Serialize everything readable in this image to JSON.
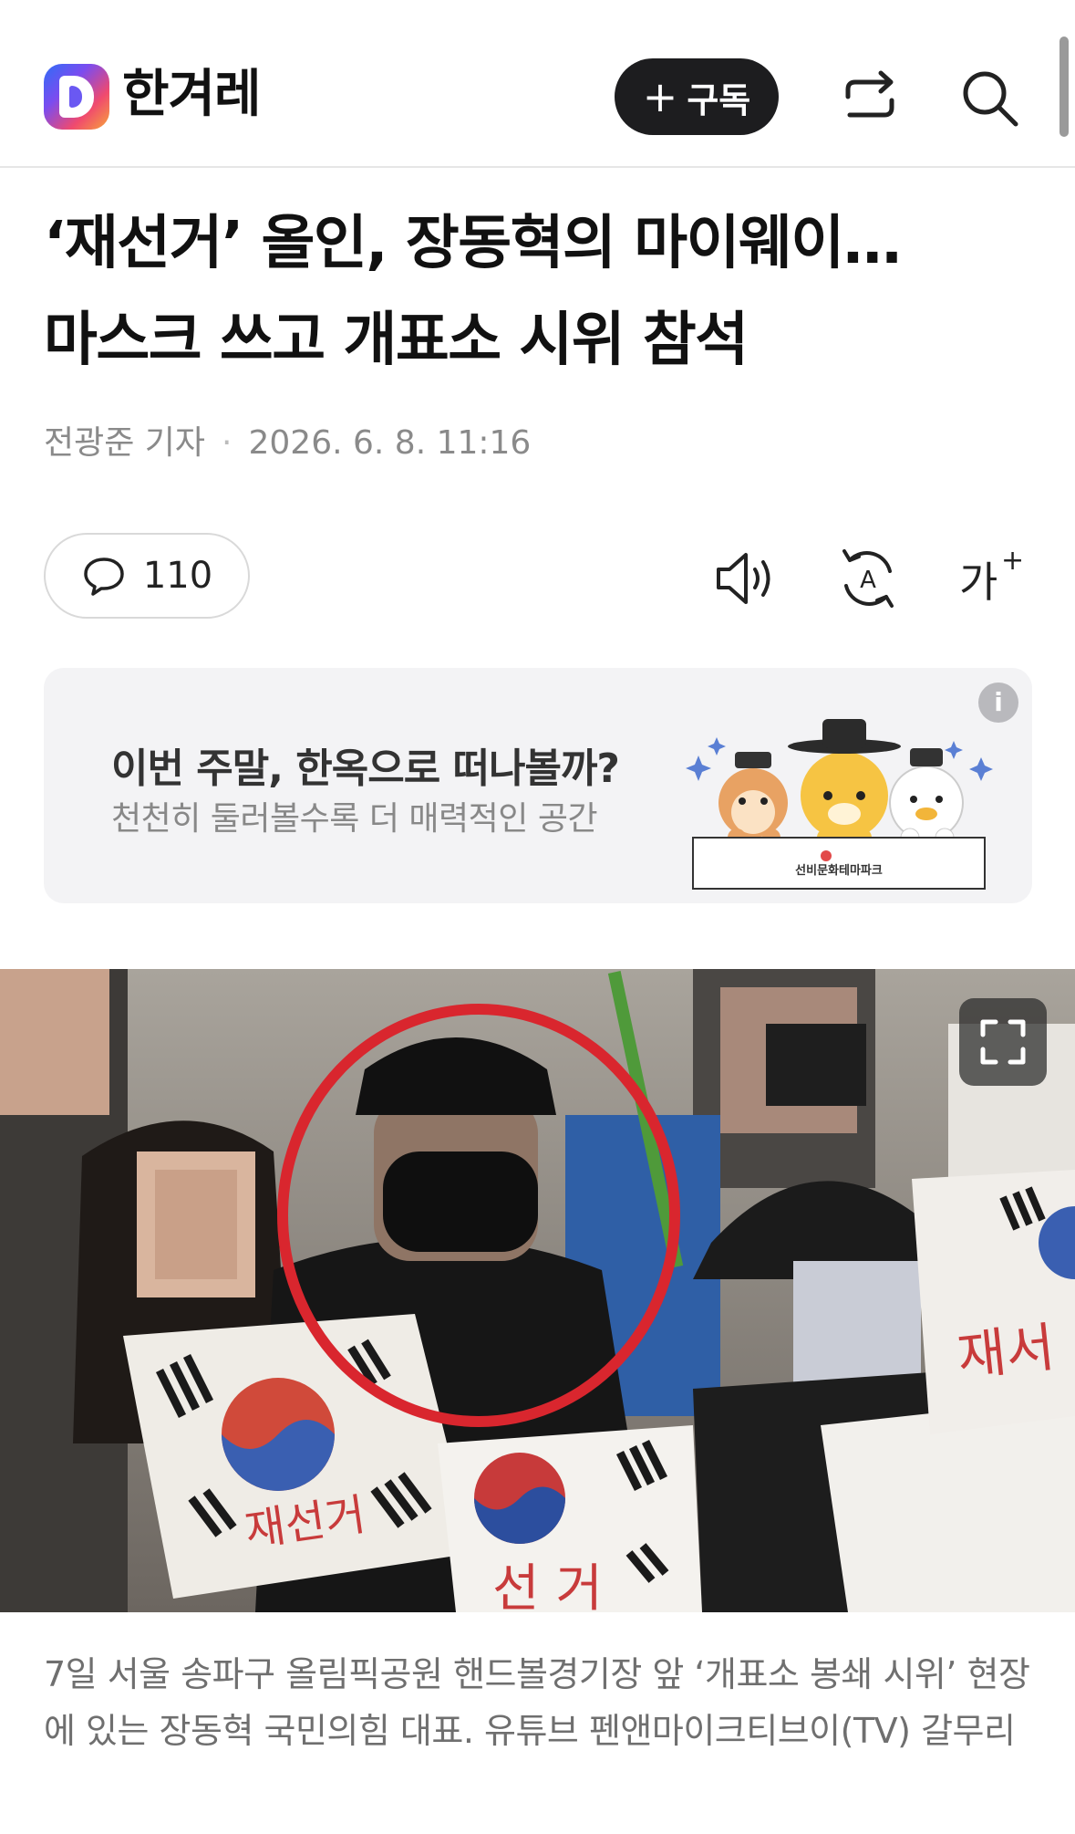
{
  "header": {
    "logo_text": "한겨레",
    "subscribe_plus": "+",
    "subscribe_label": "구독",
    "icons": {
      "logo": "daum-d-logo",
      "share": "share-icon",
      "search": "search-icon"
    }
  },
  "article": {
    "title_line1": "‘재선거’ 올인, 장동혁의 마이웨이…",
    "title_line2": "마스크 쓰고 개표소 시위 참석",
    "author": "전광준 기자",
    "byline_separator": "·",
    "date": "2026. 6. 8. 11:16"
  },
  "toolbar": {
    "comment_count": "110",
    "icons": {
      "comment": "comment-bubble-icon",
      "listen": "speaker-icon",
      "translate": "translate-icon",
      "font_size": "font-size-icon"
    },
    "font_size_glyph": "가",
    "font_size_plus": "+",
    "translate_glyph": "A"
  },
  "ad": {
    "title": "이번 주말, 한옥으로 떠나볼까?",
    "subtitle": "천천히 둘러볼수록 더 매력적인 공간",
    "info_glyph": "i",
    "sign_text": "선비문화테마파크"
  },
  "photo": {
    "sign_text_left": "재선거",
    "sign_text_right": "재서",
    "sign_text_center": "선 거"
  },
  "caption": {
    "text": "7일 서울 송파구 올림픽공원 핸드볼경기장 앞 ‘개표소 봉쇄 시위’ 현장에 있는 장동혁 국민의힘 대표. 유튜브 펜앤마이크티브이(TV) 갈무리"
  },
  "colors": {
    "accent_dark": "#1d1d1f",
    "ad_background": "#f3f3f5",
    "circle_red": "#d9262e"
  }
}
